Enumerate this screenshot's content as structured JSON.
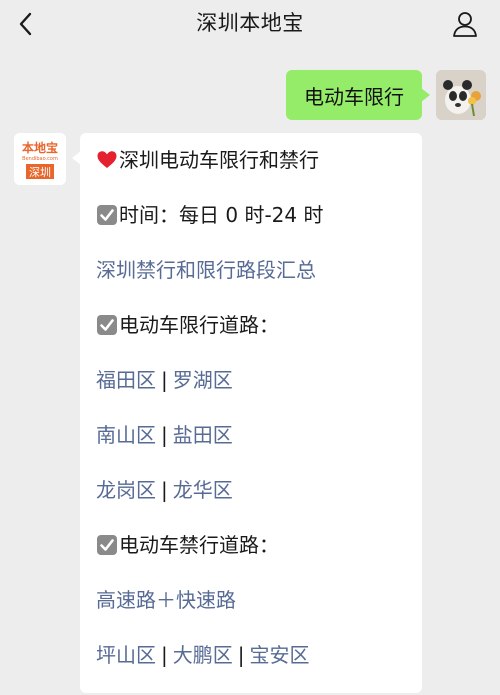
{
  "header": {
    "title": "深圳本地宝",
    "back_icon": "chevron-left-icon",
    "profile_icon": "person-icon"
  },
  "messages": {
    "outgoing": {
      "text": "电动车限行"
    },
    "incoming": {
      "avatar": {
        "logo_text": "本地宝",
        "logo_sub": "Bendibao.com",
        "city_tag": "深圳"
      },
      "heading": "深圳电动车限行和禁行",
      "time_line": "时间：每日 0 时-24 时",
      "summary_link": "深圳禁行和限行路段汇总",
      "limit_heading": "电动车限行道路：",
      "limit_rows": [
        [
          "福田区",
          "罗湖区"
        ],
        [
          "南山区",
          "盐田区"
        ],
        [
          "龙岗区",
          "龙华区"
        ]
      ],
      "ban_heading": "电动车禁行道路：",
      "ban_link": "高速路＋快速路",
      "ban_rows": [
        [
          "坪山区",
          "大鹏区",
          "宝安区"
        ]
      ],
      "separator": "|"
    }
  },
  "colors": {
    "page_bg": "#ededed",
    "bubble_out": "#95ec69",
    "bubble_in": "#ffffff",
    "link": "#576b95",
    "logo_orange": "#e8662b"
  }
}
